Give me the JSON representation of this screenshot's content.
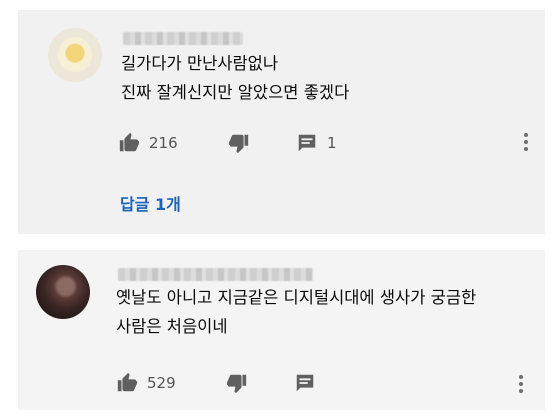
{
  "comments": [
    {
      "text_lines": [
        "길가다가 만난사람없나",
        "진짜 잘계신지만 알았으면 좋겠다"
      ],
      "likes": "216",
      "replies_count": "1",
      "replies_label": "답글 1개"
    },
    {
      "text_lines": [
        "옛날도 아니고 지금같은 디지털시대에 생사가 궁금한",
        "사람은 처음이네"
      ],
      "likes": "529"
    }
  ],
  "icons": {
    "like": "thumbs-up-icon",
    "dislike": "thumbs-down-icon",
    "reply": "comment-icon",
    "more": "more-vert-icon"
  },
  "colors": {
    "card_bg": "#f1f1f1",
    "text": "#0a0a0a",
    "meta": "#555555",
    "link": "#1a63b8"
  }
}
